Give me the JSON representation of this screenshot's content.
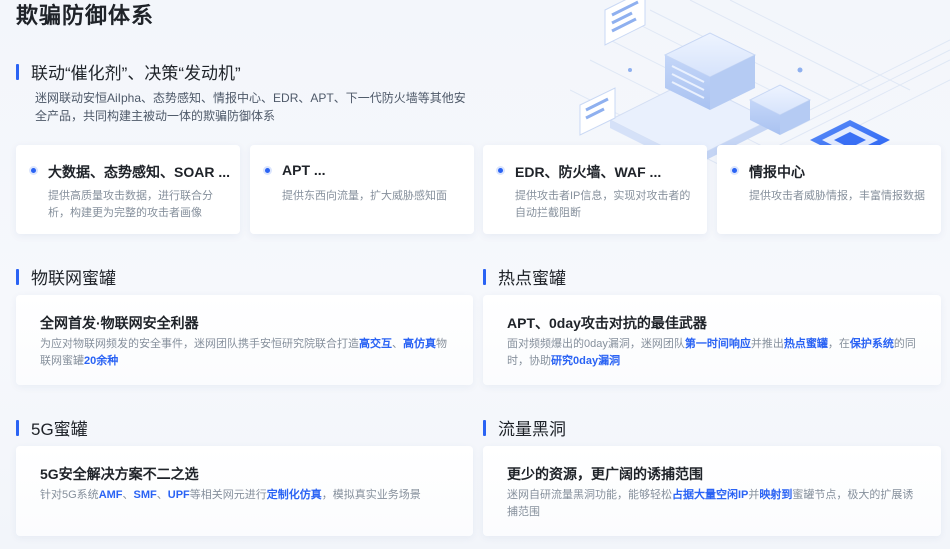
{
  "page_title": "欺骗防御体系",
  "linkage": {
    "title": "联动“催化剂”、决策“发动机”",
    "intro": "迷网联动安恒AiIpha、态势感知、情报中心、EDR、APT、下一代防火墙等其他安全产品，共同构建主被动一体的欺骗防御体系"
  },
  "cards": [
    {
      "title": "大数据、态势感知、SOAR ...",
      "desc": "提供高质量攻击数据，进行联合分析，构建更为完整的攻击者画像"
    },
    {
      "title": "APT ...",
      "desc": "提供东西向流量，扩大威胁感知面"
    },
    {
      "title": "EDR、防火墙、WAF ...",
      "desc": "提供攻击者IP信息，实现对攻击者的自动拦截阻断"
    },
    {
      "title": "情报中心",
      "desc": "提供攻击者威胁情报，丰富情报数据"
    }
  ],
  "sections": {
    "iot": {
      "title": "物联网蜜罐",
      "panel_title": "全网首发·物联网安全利器",
      "desc_parts": [
        "为应对物联网频发的安全事件，迷网团队携手安恒研究院联合打造",
        "高交互",
        "、",
        "高仿真",
        "物联网蜜罐",
        "20余种"
      ]
    },
    "hot": {
      "title": "热点蜜罐",
      "panel_title": "APT、0day攻击对抗的最佳武器",
      "desc_parts": [
        "面对频频爆出的0day漏洞，迷网团队",
        "第一时间响应",
        "并推出",
        "热点蜜罐",
        "，在",
        "保护系统",
        "的同时，协助",
        "研究0day漏洞"
      ]
    },
    "g5": {
      "title": "5G蜜罐",
      "panel_title": "5G安全解决方案不二之选",
      "desc_parts": [
        "针对5G系统",
        "AMF",
        "、",
        "SMF",
        "、",
        "UPF",
        "等相关网元进行",
        "定制化仿真",
        "，模拟真实业务场景"
      ]
    },
    "blackhole": {
      "title": "流量黑洞",
      "panel_title": "更少的资源，更广阔的诱捕范围",
      "desc_parts": [
        "迷网自研流量黑洞功能，能够轻松",
        "占据大量空闲IP",
        "并",
        "映射到",
        "蜜罐节点，极大的扩展诱捕范围"
      ]
    }
  },
  "colors": {
    "accent": "#2a63f4",
    "text": "#1f2329",
    "muted": "#86909c",
    "bg": "#f3f6fb"
  },
  "icons": {
    "bullet": "dot-icon",
    "section": "bar-icon",
    "illustration": "isometric-network-illustration"
  }
}
